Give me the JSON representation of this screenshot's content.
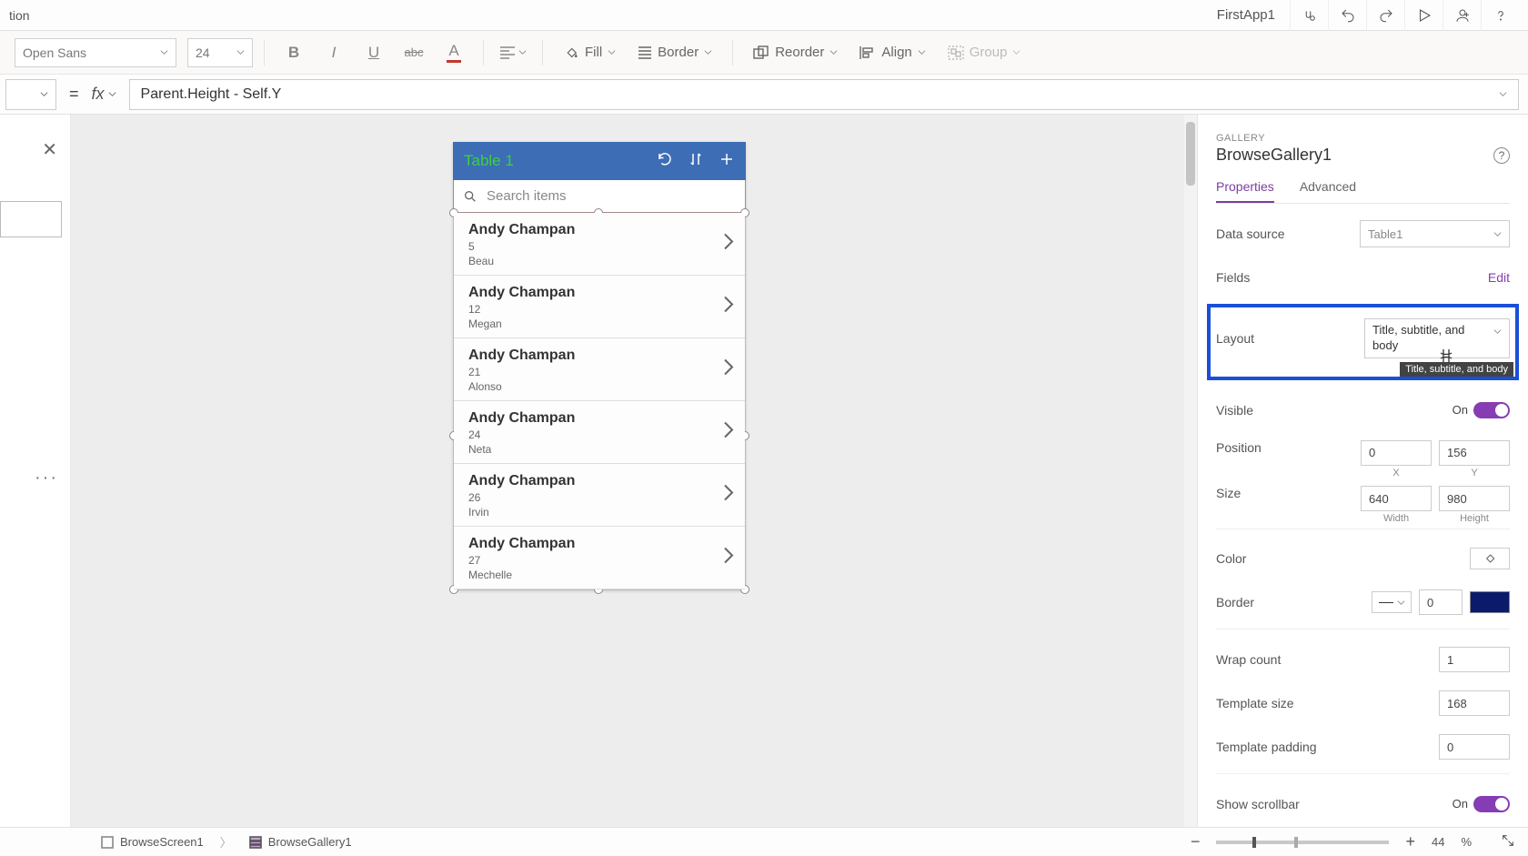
{
  "titlebar": {
    "left_fragment": "tion",
    "app_name": "FirstApp1"
  },
  "toolbar": {
    "font": "Open Sans",
    "font_size": "24",
    "fill_label": "Fill",
    "border_label": "Border",
    "reorder_label": "Reorder",
    "align_label": "Align",
    "group_label": "Group"
  },
  "formula": {
    "equals": "=",
    "fx": "fx",
    "expression": "Parent.Height - Self.Y"
  },
  "phone": {
    "header_title": "Table 1",
    "search_placeholder": "Search items",
    "items": [
      {
        "title": "Andy Champan",
        "sub": "5",
        "body": "Beau"
      },
      {
        "title": "Andy Champan",
        "sub": "12",
        "body": "Megan"
      },
      {
        "title": "Andy Champan",
        "sub": "21",
        "body": "Alonso"
      },
      {
        "title": "Andy Champan",
        "sub": "24",
        "body": "Neta"
      },
      {
        "title": "Andy Champan",
        "sub": "26",
        "body": "Irvin"
      },
      {
        "title": "Andy Champan",
        "sub": "27",
        "body": "Mechelle"
      }
    ]
  },
  "props": {
    "kind": "GALLERY",
    "name": "BrowseGallery1",
    "tabs": {
      "properties": "Properties",
      "advanced": "Advanced"
    },
    "data_source_label": "Data source",
    "data_source_value": "Table1",
    "fields_label": "Fields",
    "fields_edit": "Edit",
    "layout_label": "Layout",
    "layout_value": "Title, subtitle, and body",
    "layout_tooltip": "Title, subtitle, and body",
    "visible_label": "Visible",
    "visible_on": "On",
    "position_label": "Position",
    "pos_x": "0",
    "pos_y": "156",
    "pos_x_lbl": "X",
    "pos_y_lbl": "Y",
    "size_label": "Size",
    "size_w": "640",
    "size_h": "980",
    "size_w_lbl": "Width",
    "size_h_lbl": "Height",
    "color_label": "Color",
    "border_label": "Border",
    "border_width": "0",
    "wrap_label": "Wrap count",
    "wrap_value": "1",
    "tmpl_size_label": "Template size",
    "tmpl_size_value": "168",
    "tmpl_pad_label": "Template padding",
    "tmpl_pad_value": "0",
    "scroll_label": "Show scrollbar",
    "scroll_on": "On"
  },
  "status": {
    "crumb1": "BrowseScreen1",
    "crumb2": "BrowseGallery1",
    "zoom": "44",
    "zoom_pct": "%"
  }
}
